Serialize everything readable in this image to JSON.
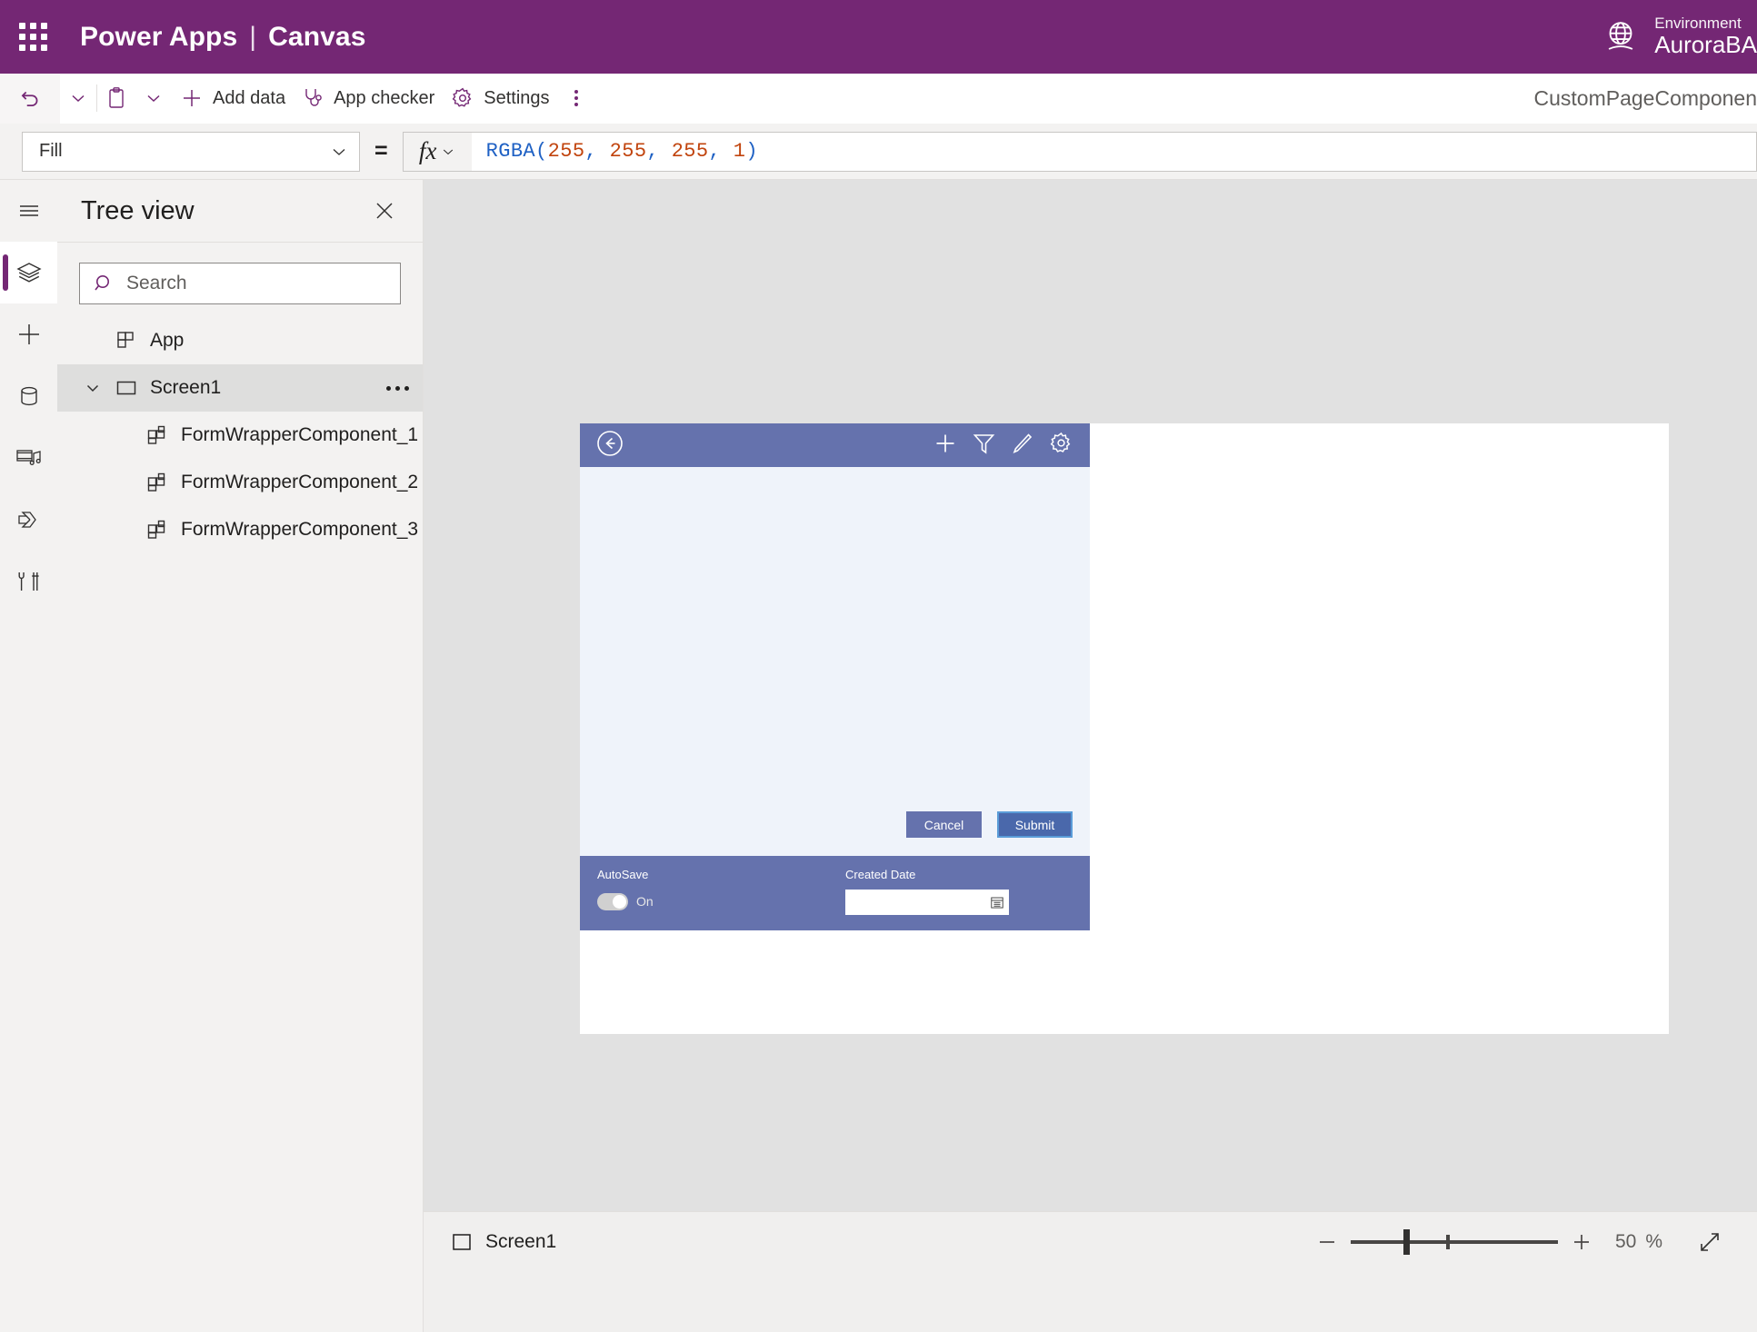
{
  "brand": {
    "waffle_icon": "app-launcher-icon",
    "product": "Power Apps",
    "separator": "|",
    "section": "Canvas",
    "environment_label": "Environment",
    "environment_name": "AuroraBA",
    "globe_icon": "globe-environment-icon",
    "bar_color": "#742774"
  },
  "commandbar": {
    "undo_icon": "undo-icon",
    "undo_chevron_icon": "chevron-down-icon",
    "paste_icon": "clipboard-paste-icon",
    "paste_chevron_icon": "chevron-down-icon",
    "add_data_icon": "plus-icon",
    "add_data_label": "Add data",
    "app_checker_icon": "stethoscope-icon",
    "app_checker_label": "App checker",
    "settings_icon": "gear-icon",
    "settings_label": "Settings",
    "overflow_icon": "more-vertical-icon",
    "document_title": "CustomPageComponen"
  },
  "formulabar": {
    "property_value": "Fill",
    "property_chevron_icon": "chevron-down-icon",
    "equals": "=",
    "fx_glyph": "fx",
    "fx_chevron_icon": "chevron-down-icon",
    "formula_tokens": [
      {
        "text": "RGBA",
        "kind": "fn"
      },
      {
        "text": "(",
        "kind": "pun"
      },
      {
        "text": "255",
        "kind": "num"
      },
      {
        "text": ", ",
        "kind": "pun"
      },
      {
        "text": "255",
        "kind": "num"
      },
      {
        "text": ", ",
        "kind": "pun"
      },
      {
        "text": "255",
        "kind": "num"
      },
      {
        "text": ", ",
        "kind": "pun"
      },
      {
        "text": "1",
        "kind": "num"
      },
      {
        "text": ")",
        "kind": "pun"
      }
    ],
    "formula_text": "RGBA(255, 255, 255, 1)"
  },
  "rail": {
    "items": [
      {
        "icon": "hamburger-menu-icon",
        "name": "menu",
        "selected": false
      },
      {
        "icon": "layers-tree-view-icon",
        "name": "tree-view",
        "selected": true
      },
      {
        "icon": "plus-insert-icon",
        "name": "insert",
        "selected": false
      },
      {
        "icon": "database-data-icon",
        "name": "data",
        "selected": false
      },
      {
        "icon": "media-icon",
        "name": "media",
        "selected": false
      },
      {
        "icon": "power-automate-icon",
        "name": "power-automate",
        "selected": false
      },
      {
        "icon": "variables-tools-icon",
        "name": "variables",
        "selected": false
      }
    ]
  },
  "treeview": {
    "title": "Tree view",
    "close_icon": "close-icon",
    "search": {
      "placeholder": "Search",
      "value": "",
      "icon": "search-icon"
    },
    "items": [
      {
        "label": "App",
        "icon": "app-icon",
        "indent": 0,
        "selected": false,
        "twisty": "",
        "more": false
      },
      {
        "label": "Screen1",
        "icon": "screen-icon",
        "indent": 1,
        "selected": true,
        "twisty": "expanded",
        "more": true
      },
      {
        "label": "FormWrapperComponent_1",
        "icon": "component-icon",
        "indent": 2,
        "selected": false,
        "twisty": "",
        "more": false
      },
      {
        "label": "FormWrapperComponent_2",
        "icon": "component-icon",
        "indent": 2,
        "selected": false,
        "twisty": "",
        "more": false
      },
      {
        "label": "FormWrapperComponent_3",
        "icon": "component-icon",
        "indent": 2,
        "selected": false,
        "twisty": "",
        "more": false
      }
    ]
  },
  "canvas": {
    "background": "#e1e1e1",
    "screen_background": "#ffffff",
    "component": {
      "header_color": "#6572ad",
      "body_color": "#eff3fa",
      "back_icon": "back-arrow-circle-icon",
      "header_icons": [
        "plus-icon",
        "filter-icon",
        "pencil-edit-icon",
        "gear-settings-icon"
      ],
      "cancel_label": "Cancel",
      "submit_label": "Submit",
      "autosave_label": "AutoSave",
      "autosave_toggle_state": "On",
      "created_date_label": "Created Date",
      "created_date_value": "",
      "calendar_icon": "calendar-icon"
    }
  },
  "statusbar": {
    "screen_icon": "screen-icon",
    "screen_label": "Screen1",
    "zoom_out_icon": "minus-icon",
    "zoom_in_icon": "plus-icon",
    "zoom_value": "50",
    "zoom_unit": "%",
    "fit_icon": "fit-to-screen-icon"
  }
}
